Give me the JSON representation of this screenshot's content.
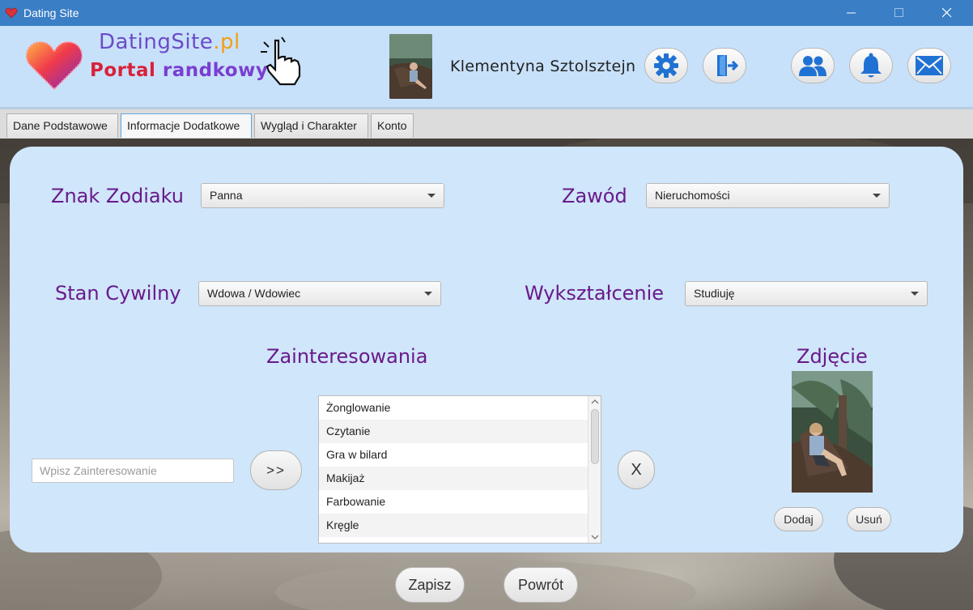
{
  "window": {
    "title": "Dating Site",
    "icon": "heart-icon"
  },
  "header": {
    "logo_site": "DatingSite",
    "logo_tld": ".pl",
    "logo_tagline_1": "Portal",
    "logo_tagline_2": "randkowy",
    "user_name": "Klementyna Sztolsztejn",
    "buttons": [
      {
        "icon": "gear-icon"
      },
      {
        "icon": "logout-icon"
      },
      {
        "icon": "users-icon"
      },
      {
        "icon": "bell-icon"
      },
      {
        "icon": "envelope-icon"
      }
    ],
    "accent_color": "#1f72d3"
  },
  "tabs": [
    {
      "label": "Dane Podstawowe",
      "active": false
    },
    {
      "label": "Informacje Dodatkowe",
      "active": true
    },
    {
      "label": "Wygląd i Charakter",
      "active": false
    },
    {
      "label": "Konto",
      "active": false
    }
  ],
  "form": {
    "zodiac": {
      "label": "Znak Zodiaku",
      "value": "Panna"
    },
    "job": {
      "label": "Zawód",
      "value": "Nieruchomości"
    },
    "civil": {
      "label": "Stan Cywilny",
      "value": "Wdowa / Wdowiec"
    },
    "education": {
      "label": "Wykształcenie",
      "value": "Studiuję"
    },
    "interests": {
      "label": "Zainteresowania",
      "input_placeholder": "Wpisz Zainteresowanie",
      "add_label": ">>",
      "remove_label": "X",
      "items": [
        "Żonglowanie",
        "Czytanie",
        "Gra w bilard",
        "Makijaż",
        "Farbowanie",
        "Kręgle"
      ]
    },
    "photo": {
      "label": "Zdjęcie",
      "add_label": "Dodaj",
      "remove_label": "Usuń"
    }
  },
  "footer": {
    "save_label": "Zapisz",
    "back_label": "Powrót"
  },
  "colors": {
    "label_purple": "#6a1a8a",
    "card_bg": "#cfe6fb",
    "titlebar": "#3a7ec6"
  }
}
